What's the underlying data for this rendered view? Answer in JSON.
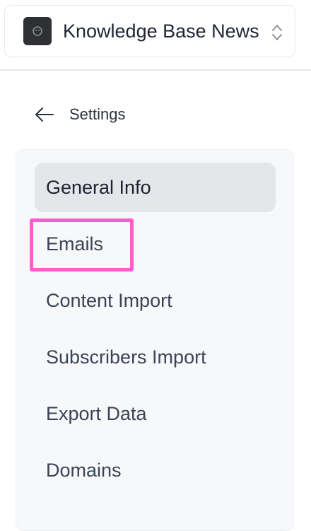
{
  "workspace": {
    "name": "Knowledge Base News",
    "logo_icon": "workspace-logo-icon",
    "switch_icon": "chevron-up-down-icon"
  },
  "back": {
    "label": "Settings",
    "icon": "arrow-left-icon"
  },
  "nav": {
    "items": [
      {
        "label": "General Info",
        "active": true
      },
      {
        "label": "Emails",
        "active": false,
        "highlighted": true
      },
      {
        "label": "Content Import",
        "active": false
      },
      {
        "label": "Subscribers Import",
        "active": false
      },
      {
        "label": "Export Data",
        "active": false
      },
      {
        "label": "Domains",
        "active": false
      }
    ]
  },
  "colors": {
    "active_bg": "#e4e6ea",
    "panel_bg": "#f7f8fa",
    "highlight": "#ff5ccd"
  }
}
